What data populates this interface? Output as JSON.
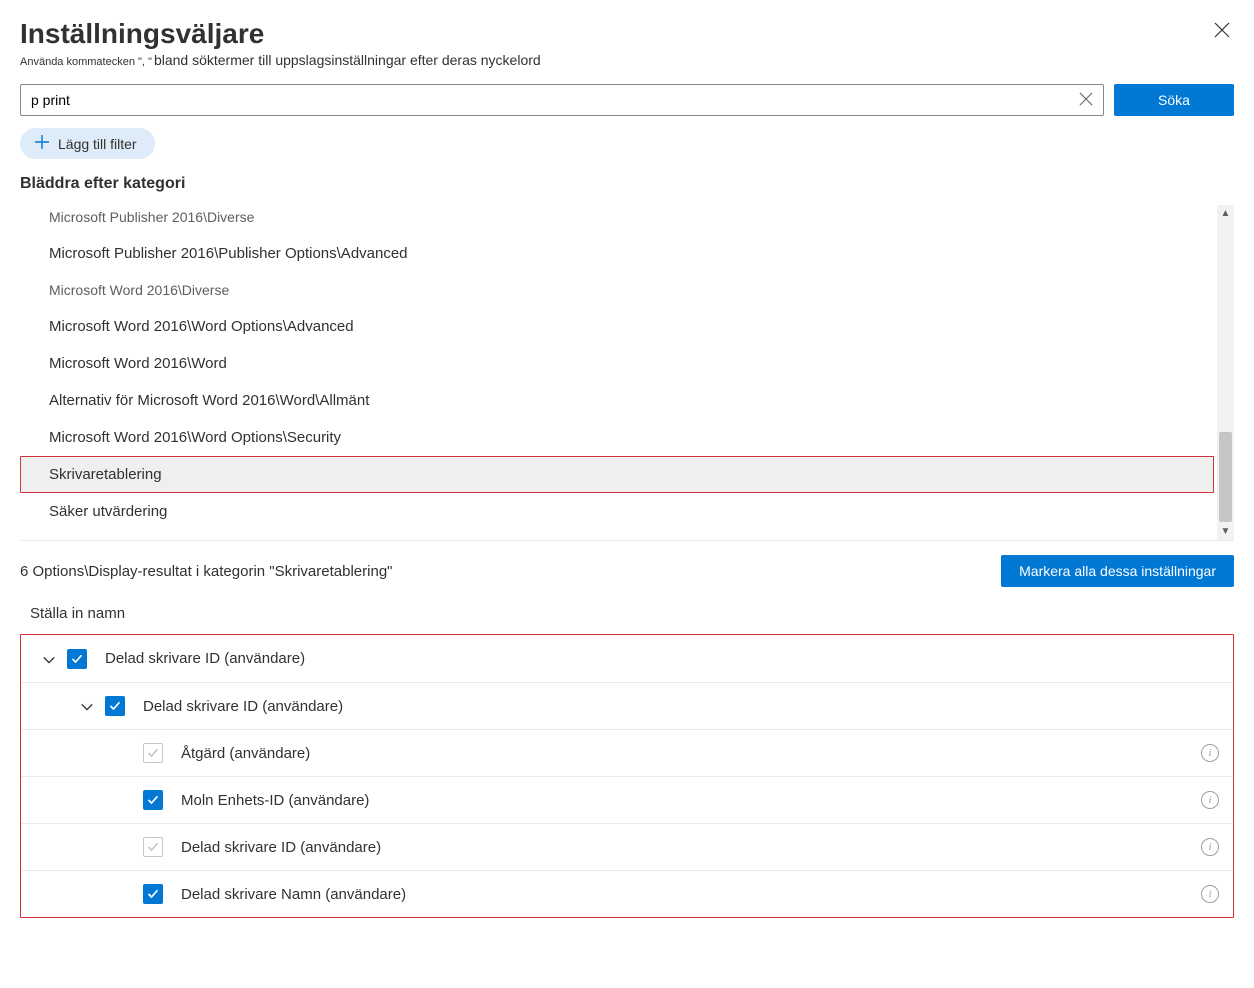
{
  "header": {
    "title": "Inställningsväljare",
    "subtitle_small": "Använda kommatecken \", \"",
    "subtitle_rest": "bland söktermer till uppslagsinställningar efter deras nyckelord"
  },
  "search": {
    "value": "p print",
    "button": "Söka"
  },
  "filter_pill": "Lägg till filter",
  "browse_header": "Bläddra efter kategori",
  "categories": [
    {
      "label": "Microsoft Publisher 2016\\Diverse",
      "muted": true,
      "selected": false
    },
    {
      "label": "Microsoft Publisher 2016\\Publisher Options\\Advanced",
      "muted": false,
      "selected": false
    },
    {
      "label": "Microsoft Word 2016\\Diverse",
      "muted": true,
      "selected": false
    },
    {
      "label": "Microsoft Word 2016\\Word Options\\Advanced",
      "muted": false,
      "selected": false
    },
    {
      "label": "Microsoft Word 2016\\Word",
      "muted": false,
      "selected": false
    },
    {
      "label": "Alternativ för Microsoft Word 2016\\Word\\Allmänt",
      "muted": false,
      "selected": false
    },
    {
      "label": "Microsoft Word 2016\\Word Options\\Security",
      "muted": false,
      "selected": false
    },
    {
      "label": "Skrivaretablering",
      "muted": false,
      "selected": true
    },
    {
      "label": "Säker utvärdering",
      "muted": false,
      "selected": false
    }
  ],
  "results": {
    "count_text": "6 Options\\Display-resultat i kategorin \"Skrivaretablering\"",
    "select_all": "Markera alla dessa inställningar"
  },
  "column_header": "Ställa in namn",
  "rows": [
    {
      "indent": 0,
      "chevron": true,
      "checked": true,
      "label": "Delad skrivare   ID (användare)",
      "info": false
    },
    {
      "indent": 1,
      "chevron": true,
      "checked": true,
      "label": "Delad skrivare   ID (användare)",
      "info": false
    },
    {
      "indent": 2,
      "chevron": false,
      "checked": false,
      "label": "Åtgärd (användare)",
      "info": true
    },
    {
      "indent": 2,
      "chevron": false,
      "checked": true,
      "label": "Moln    Enhets-ID (användare)",
      "info": true
    },
    {
      "indent": 2,
      "chevron": false,
      "checked": false,
      "label": "Delad skrivare    ID (användare)",
      "info": true
    },
    {
      "indent": 2,
      "chevron": false,
      "checked": true,
      "label": "Delad skrivare   Namn (användare)",
      "info": true
    }
  ]
}
